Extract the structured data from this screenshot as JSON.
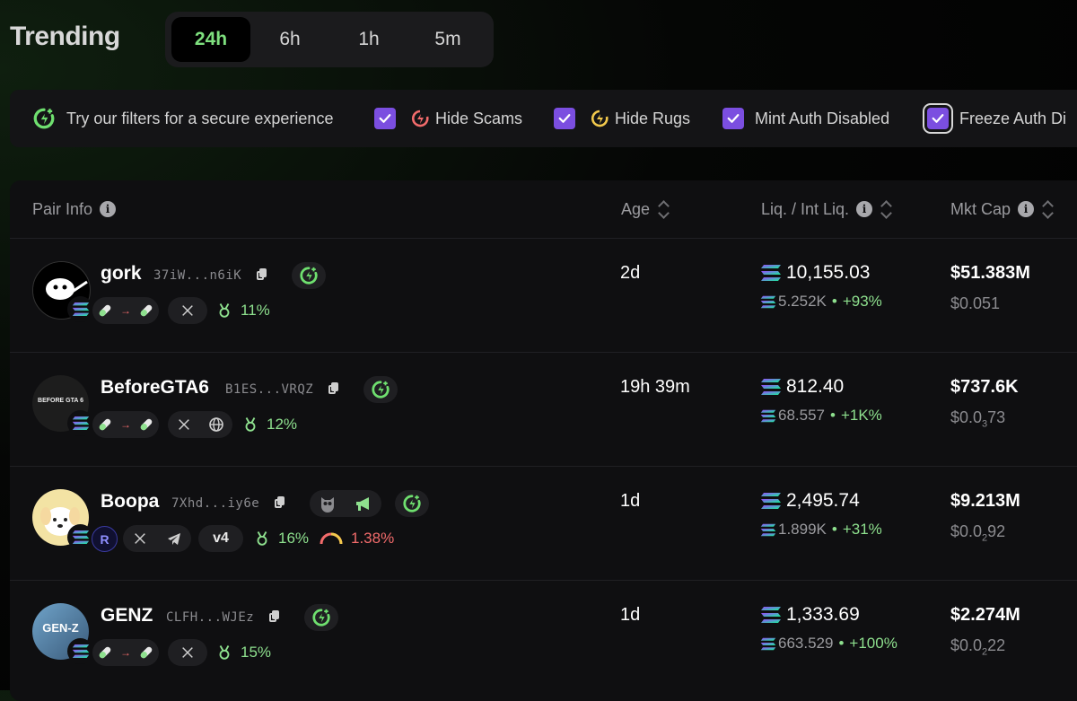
{
  "page": {
    "title": "Trending"
  },
  "timeframes": {
    "items": [
      "24h",
      "6h",
      "1h",
      "5m"
    ],
    "active": "24h"
  },
  "filters": {
    "hint": "Try our filters for a secure experience",
    "hide_scams": "Hide Scams",
    "hide_rugs": "Hide Rugs",
    "mint_auth": "Mint Auth Disabled",
    "freeze_auth": "Freeze Auth Di"
  },
  "columns": {
    "pair_info": "Pair Info",
    "age": "Age",
    "liq": "Liq. / Int Liq.",
    "mcap": "Mkt Cap"
  },
  "rows": [
    {
      "name": "gork",
      "address": "37iW...n6iK",
      "pct": "11%",
      "age": "2d",
      "liq": "10,155.03",
      "int_liq": "5.252K",
      "liq_change": "+93%",
      "mcap": "$51.383M",
      "price": "$0.051"
    },
    {
      "name": "BeforeGTA6",
      "address": "B1ES...VRQZ",
      "pct": "12%",
      "age": "19h 39m",
      "liq": "812.40",
      "int_liq": "68.557",
      "liq_change": "+1K%",
      "mcap": "$737.6K",
      "price_main": "$0.0",
      "price_sub": "3",
      "price_tail": "73",
      "avatar_text": "BEFORE GTA 6"
    },
    {
      "name": "Boopa",
      "address": "7Xhd...iy6e",
      "pct": "16%",
      "extra_tag": "v4",
      "gauge_pct": "1.38%",
      "age": "1d",
      "liq": "2,495.74",
      "int_liq": "1.899K",
      "liq_change": "+31%",
      "mcap": "$9.213M",
      "price_main": "$0.0",
      "price_sub": "2",
      "price_tail": "92"
    },
    {
      "name": "GENZ",
      "address": "CLFH...WJEz",
      "pct": "15%",
      "age": "1d",
      "liq": "1,333.69",
      "int_liq": "663.529",
      "liq_change": "+100%",
      "mcap": "$2.274M",
      "price_main": "$0.0",
      "price_sub": "2",
      "price_tail": "22",
      "avatar_text": "GEN-Z"
    }
  ],
  "colors": {
    "accent_green": "#7ee07e",
    "checkbox": "#7b4ee0",
    "negative": "#f26b6b"
  }
}
